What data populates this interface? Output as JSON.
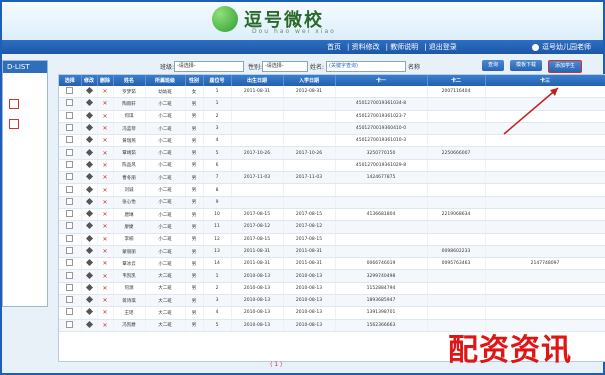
{
  "header": {
    "logo_text": "逗号微校",
    "logo_sub": "Dou hao wei xiao"
  },
  "nav": {
    "links": [
      "首页",
      "资料修改",
      "教师说明",
      "退出登录"
    ],
    "user_text": "逗号幼儿园老师"
  },
  "left_panel": {
    "title": "D-LIST"
  },
  "toolbar": {
    "class_label": "班级:",
    "class_value": "-请选择-",
    "gender_label": "性别:",
    "gender_value": "-请选择-",
    "name_label": "姓名:",
    "name_placeholder": "(关键字查询)",
    "name_suffix": "名称",
    "search_button": "查询",
    "import_button": "模板下载",
    "add_button": "添加学生"
  },
  "table": {
    "columns": [
      "选择",
      "修改",
      "删除",
      "姓名",
      "所属班级",
      "性别",
      "座位号",
      "出生日期",
      "入学日期",
      "卡一",
      "卡二",
      "卡三"
    ],
    "rows": [
      [
        "",
        "",
        "",
        "罗梦茹",
        "幼幼班",
        "女",
        "1",
        "2011-08-31",
        "2012-08-31",
        "",
        "2007116404",
        ""
      ],
      [
        "",
        "",
        "",
        "陶雨轩",
        "小二班",
        "男",
        "1",
        "",
        "",
        "4501270019361034-8",
        "",
        ""
      ],
      [
        "",
        "",
        "",
        "何琪",
        "小二班",
        "男",
        "2",
        "",
        "",
        "4501270019361023-7",
        "",
        ""
      ],
      [
        "",
        "",
        "",
        "冯蓝菲",
        "小二班",
        "男",
        "3",
        "",
        "",
        "4501270019360410-0",
        "",
        ""
      ],
      [
        "",
        "",
        "",
        "黄瑞燕",
        "小二班",
        "男",
        "4",
        "",
        "",
        "4501270019361010-3",
        "",
        ""
      ],
      [
        "",
        "",
        "",
        "覃靖茹",
        "小二班",
        "男",
        "5",
        "2017-10-26",
        "2017-10-26",
        "3250770150",
        "2250666007",
        ""
      ],
      [
        "",
        "",
        "",
        "陈品风",
        "小二班",
        "男",
        "6",
        "",
        "",
        "4501270019361029-8",
        "",
        ""
      ],
      [
        "",
        "",
        "",
        "曹冬丽",
        "小二班",
        "男",
        "7",
        "2017-11-03",
        "2017-11-03",
        "1424677875",
        "",
        ""
      ],
      [
        "",
        "",
        "",
        "刘诚",
        "小二班",
        "男",
        "8",
        "",
        "",
        "",
        "",
        ""
      ],
      [
        "",
        "",
        "",
        "张心怡",
        "小二班",
        "男",
        "9",
        "",
        "",
        "",
        "",
        ""
      ],
      [
        "",
        "",
        "",
        "唐琳",
        "小二班",
        "男",
        "10",
        "2017-08-15",
        "2017-08-15",
        "4136681804",
        "2219068634",
        ""
      ],
      [
        "",
        "",
        "",
        "廖婕",
        "小二班",
        "男",
        "11",
        "2017-08-12",
        "2017-08-12",
        "",
        "",
        ""
      ],
      [
        "",
        "",
        "",
        "李楠",
        "小二班",
        "男",
        "12",
        "2017-08-15",
        "2017-08-15",
        "",
        "",
        ""
      ],
      [
        "",
        "",
        "",
        "蒙丽丽",
        "小二班",
        "男",
        "13",
        "2011-08-31",
        "2011-08-31",
        "",
        "0098602233",
        ""
      ],
      [
        "",
        "",
        "",
        "覃冰云",
        "小二班",
        "男",
        "14",
        "2011-08-31",
        "2011-08-31",
        "0066746019",
        "0095763463",
        "2147748097"
      ],
      [
        "",
        "",
        "",
        "韦凯凯",
        "大二班",
        "男",
        "1",
        "2010-08-13",
        "2010-08-13",
        "3299740498",
        "",
        ""
      ],
      [
        "",
        "",
        "",
        "何源",
        "大二班",
        "男",
        "2",
        "2010-08-13",
        "2010-08-13",
        "1152884794",
        "",
        ""
      ],
      [
        "",
        "",
        "",
        "蒋诗琪",
        "大二班",
        "男",
        "3",
        "2010-08-13",
        "2010-08-13",
        "1893685947",
        "",
        ""
      ],
      [
        "",
        "",
        "",
        "王瑶",
        "大二班",
        "男",
        "4",
        "2010-08-13",
        "2010-08-13",
        "1391398701",
        "",
        ""
      ],
      [
        "",
        "",
        "",
        "冯凯爵",
        "大二班",
        "男",
        "5",
        "2010-08-13",
        "2010-08-13",
        "1562366663",
        "",
        ""
      ]
    ]
  },
  "pager": {
    "text": "⟨ 1 ⟩"
  },
  "watermark": {
    "text": "配资资讯"
  }
}
